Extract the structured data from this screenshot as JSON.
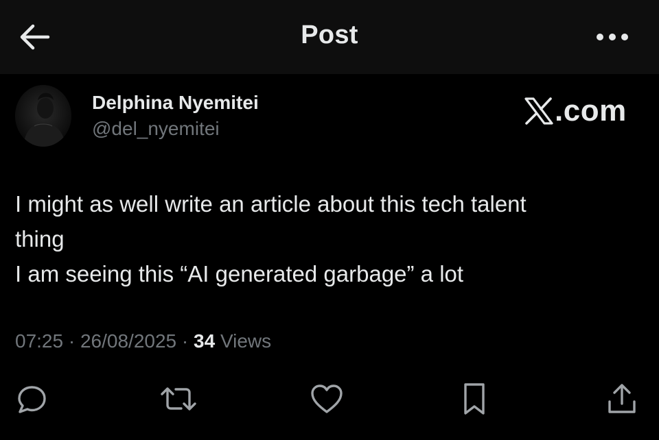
{
  "header": {
    "back_icon": "arrow-left-icon",
    "title": "Post",
    "more_icon": "more-horizontal-icon"
  },
  "author": {
    "display_name": "Delphina Nyemitei",
    "handle": "@del_nyemitei",
    "avatar_icon": "avatar"
  },
  "watermark": {
    "text": ".com",
    "logo_icon": "x-logo-icon"
  },
  "post": {
    "lines": [
      "I might as well write an article about this tech talent",
      "thing",
      "I am seeing this “AI generated garbage” a lot"
    ]
  },
  "meta": {
    "time": "07:25",
    "date": "26/08/2025",
    "views_count": "34",
    "views_label": "Views",
    "separator": "·"
  },
  "actions": [
    {
      "name": "reply",
      "icon": "reply-icon"
    },
    {
      "name": "repost",
      "icon": "repost-icon"
    },
    {
      "name": "like",
      "icon": "heart-icon"
    },
    {
      "name": "bookmark",
      "icon": "bookmark-icon"
    },
    {
      "name": "share",
      "icon": "share-icon"
    }
  ],
  "colors": {
    "background": "#000000",
    "header_bg": "#0e0e0e",
    "text_primary": "#e7e9ea",
    "text_secondary": "#71767b"
  }
}
